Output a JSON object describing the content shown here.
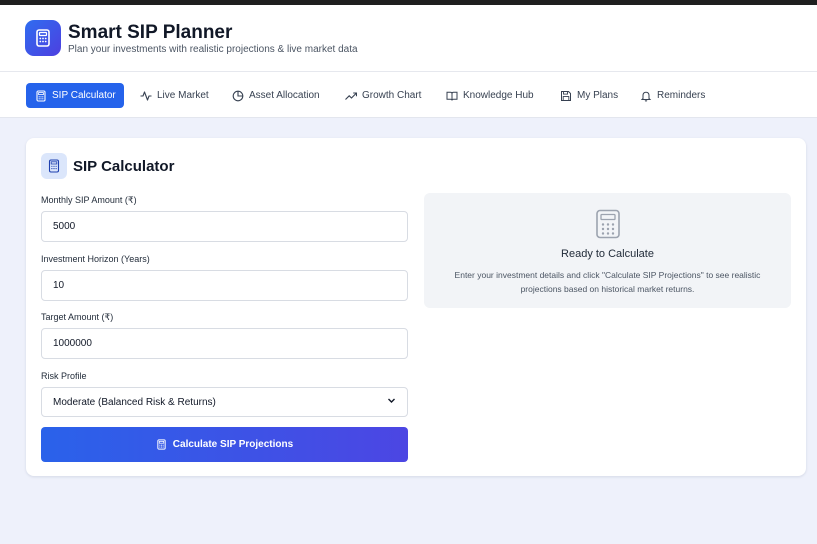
{
  "app": {
    "title": "Smart SIP Planner",
    "subtitle": "Plan your investments with realistic projections & live market data"
  },
  "nav": {
    "tabs": [
      {
        "label": "SIP Calculator",
        "icon": "calculator-icon",
        "active": true
      },
      {
        "label": "Live Market",
        "icon": "activity-icon"
      },
      {
        "label": "Asset Allocation",
        "icon": "pie-chart-icon"
      },
      {
        "label": "Growth Chart",
        "icon": "trending-up-icon"
      },
      {
        "label": "Knowledge Hub",
        "icon": "book-icon"
      },
      {
        "label": "My Plans",
        "icon": "save-icon"
      },
      {
        "label": "Reminders",
        "icon": "bell-icon"
      }
    ]
  },
  "calculator": {
    "title": "SIP Calculator",
    "fields": {
      "monthly": {
        "label": "Monthly SIP Amount (₹)",
        "value": "5000"
      },
      "horizon": {
        "label": "Investment Horizon (Years)",
        "value": "10"
      },
      "target": {
        "label": "Target Amount (₹)",
        "value": "1000000"
      },
      "risk": {
        "label": "Risk Profile",
        "value": "Moderate (Balanced Risk & Returns)"
      }
    },
    "button_label": "Calculate SIP Projections"
  },
  "ready": {
    "title": "Ready to Calculate",
    "description": "Enter your investment details and click \"Calculate SIP Projections\" to see realistic projections based on historical market returns."
  },
  "colors": {
    "accent": "#2563eb",
    "accent_gradient_end": "#4c46e3",
    "page_background": "#eef1fb"
  }
}
